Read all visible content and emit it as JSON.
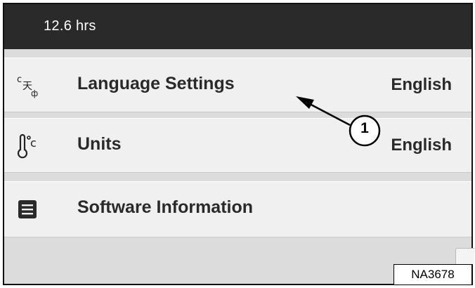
{
  "status_bar": {
    "hours": "12.6 hrs"
  },
  "settings": [
    {
      "icon": "language-icon",
      "label": "Language Settings",
      "value": "English"
    },
    {
      "icon": "thermometer-celsius-icon",
      "label": "Units",
      "value": "English"
    },
    {
      "icon": "document-info-icon",
      "label": "Software Information",
      "value": ""
    }
  ],
  "callout": {
    "number": "1"
  },
  "reference_code": "NA3678"
}
